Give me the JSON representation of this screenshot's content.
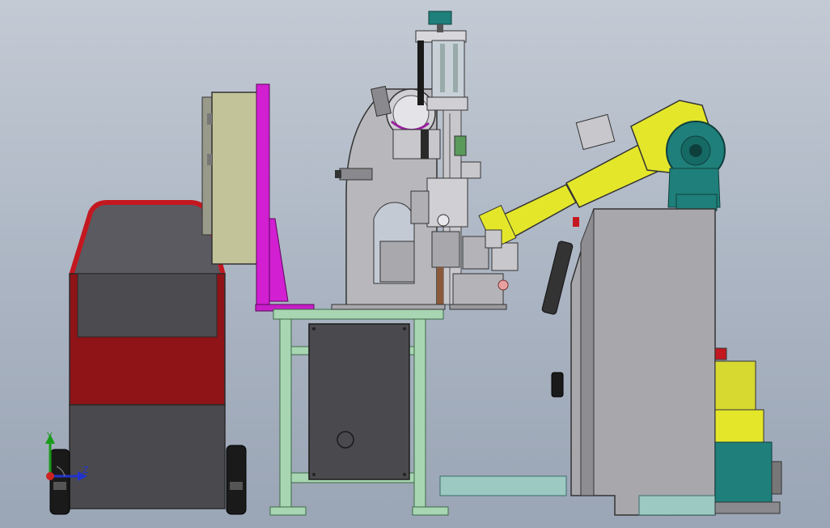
{
  "viewport": {
    "background_top": "#c3cad4",
    "background_bottom": "#9aa5b5"
  },
  "triad": {
    "y_label": "Y",
    "z_label": "Z",
    "y_color": "#1a9a1a",
    "z_color": "#2233cc",
    "origin_color": "#cc2222"
  },
  "colors": {
    "cart_red": "#8e1418",
    "cart_dark": "#505055",
    "frame_green": "#a8d5b2",
    "machine_gray": "#b8b8bc",
    "magenta_panel": "#d11fd1",
    "robot_yellow": "#e4e62a",
    "robot_teal": "#1f7f7a",
    "cabinet_gray": "#a8a8ac",
    "control_box": "#c3c39a"
  }
}
